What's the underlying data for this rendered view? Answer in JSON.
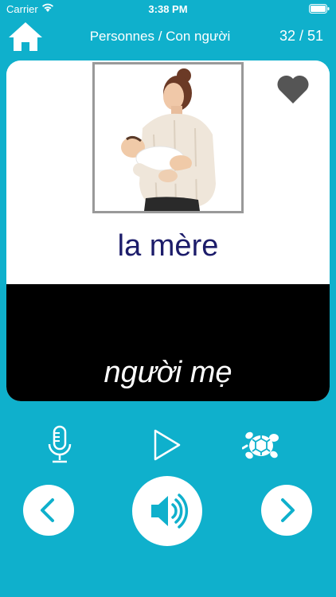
{
  "status": {
    "carrier": "Carrier",
    "time": "3:38 PM"
  },
  "nav": {
    "title": "Personnes / Con người",
    "counter": "32 / 51"
  },
  "card": {
    "word_fr": "la mère",
    "word_vi": "người mẹ"
  },
  "icons": {
    "home": "home-icon",
    "heart": "heart-icon",
    "mic": "microphone-icon",
    "play": "play-icon",
    "turtle": "turtle-icon",
    "prev": "chevron-left-icon",
    "speaker": "speaker-icon",
    "next": "chevron-right-icon"
  },
  "colors": {
    "background": "#0fb0cc",
    "word_fr": "#1c1c6a",
    "heart": "#555555"
  }
}
